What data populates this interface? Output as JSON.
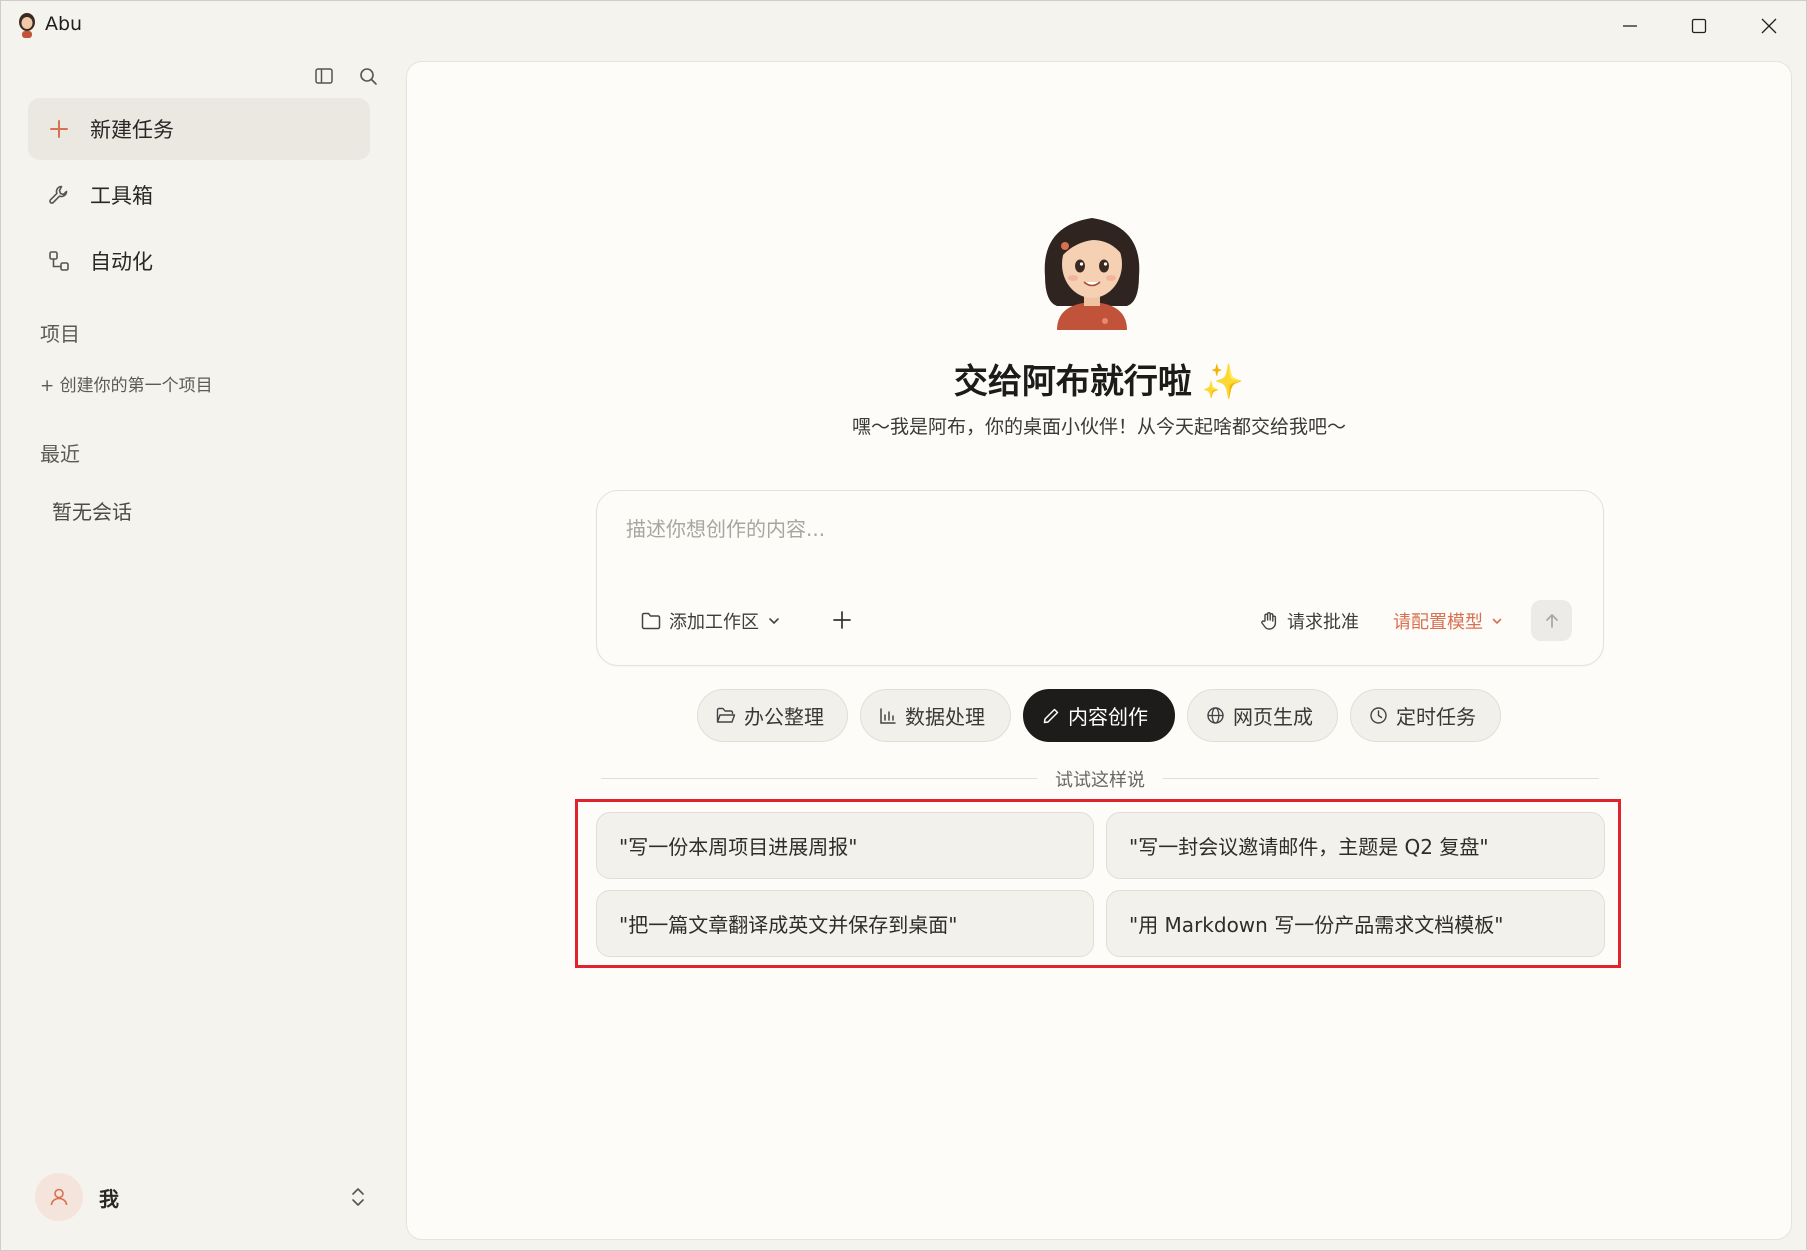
{
  "app": {
    "title": "Abu"
  },
  "window_controls": {
    "minimize": "minimize-icon",
    "maximize": "maximize-icon",
    "close": "close-icon"
  },
  "sidebar": {
    "top_icons": [
      "sidebar-toggle-icon",
      "search-icon"
    ],
    "nav": [
      {
        "label": "新建任务",
        "icon": "plus-icon",
        "active": true
      },
      {
        "label": "工具箱",
        "icon": "wrench-icon",
        "active": false
      },
      {
        "label": "自动化",
        "icon": "workflow-icon",
        "active": false
      }
    ],
    "projects_heading": "项目",
    "create_project": "+ 创建你的第一个项目",
    "recent_heading": "最近",
    "recent_empty": "暂无会话",
    "user": {
      "name": "我"
    }
  },
  "hero": {
    "title": "交给阿布就行啦",
    "sparkle": "✨",
    "subtitle": "嘿～我是阿布，你的桌面小伙伴！从今天起啥都交给我吧～"
  },
  "composer": {
    "placeholder": "描述你想创作的内容...",
    "workspace_label": "添加工作区",
    "approval_label": "请求批准",
    "model_label": "请配置模型",
    "colors": {
      "model_accent": "#d9704f"
    }
  },
  "categories": [
    {
      "label": "办公整理",
      "icon": "folder-open-icon",
      "active": false
    },
    {
      "label": "数据处理",
      "icon": "bar-chart-icon",
      "active": false
    },
    {
      "label": "内容创作",
      "icon": "pen-icon",
      "active": true
    },
    {
      "label": "网页生成",
      "icon": "globe-icon",
      "active": false
    },
    {
      "label": "定时任务",
      "icon": "clock-icon",
      "active": false
    }
  ],
  "suggestions": {
    "heading": "试试这样说",
    "items": [
      "\"写一份本周项目进展周报\"",
      "\"写一封会议邀请邮件，主题是 Q2 复盘\"",
      "\"把一篇文章翻译成英文并保存到桌面\"",
      "\"用 Markdown 写一份产品需求文档模板\""
    ],
    "highlight_color": "#e0232c"
  }
}
